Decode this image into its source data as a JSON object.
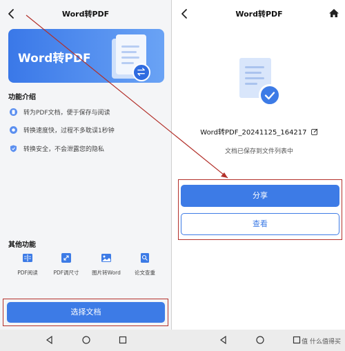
{
  "left": {
    "header": {
      "title": "Word转PDF"
    },
    "banner": {
      "title": "Word转PDF"
    },
    "features": {
      "title": "功能介绍",
      "items": [
        {
          "icon": "doc-icon",
          "label": "转为PDF文档，便于保存与阅读"
        },
        {
          "icon": "speed-icon",
          "label": "转换速度快，过程不多耽误1秒钟"
        },
        {
          "icon": "shield-icon",
          "label": "转换安全，不会泄露您的隐私"
        }
      ]
    },
    "other": {
      "title": "其他功能",
      "tools": [
        {
          "icon": "book-icon",
          "label": "PDF阅读"
        },
        {
          "icon": "resize-icon",
          "label": "PDF调尺寸"
        },
        {
          "icon": "image-icon",
          "label": "图片转Word"
        },
        {
          "icon": "search-doc-icon",
          "label": "论文查重"
        }
      ]
    },
    "select_button": "选择文档"
  },
  "right": {
    "header": {
      "title": "Word转PDF"
    },
    "filename": "Word转PDF_20241125_164217",
    "saved_text": "文档已保存到文件列表中",
    "share_button": "分享",
    "view_button": "查看"
  },
  "watermark": "值 什么值得买",
  "colors": {
    "accent": "#3d7be6",
    "highlight": "#b3302a"
  }
}
